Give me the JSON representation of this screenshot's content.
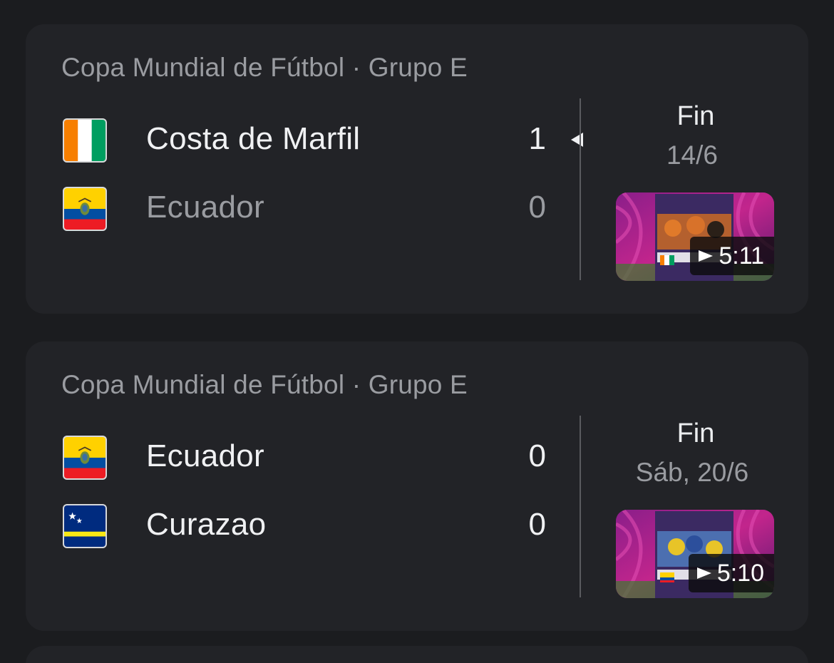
{
  "matches": [
    {
      "league": "Copa Mundial de Fútbol · Grupo E",
      "status": "Fin",
      "date": "14/6",
      "video_duration": "5:11",
      "teams": [
        {
          "name": "Costa de Marfil",
          "score": "1",
          "flag": "ivory-coast-flag-icon",
          "winner": true
        },
        {
          "name": "Ecuador",
          "score": "0",
          "flag": "ecuador-flag-icon",
          "winner": false
        }
      ]
    },
    {
      "league": "Copa Mundial de Fútbol · Grupo E",
      "status": "Fin",
      "date": "Sáb, 20/6",
      "video_duration": "5:10",
      "teams": [
        {
          "name": "Ecuador",
          "score": "0",
          "flag": "ecuador-flag-icon",
          "winner": false
        },
        {
          "name": "Curazao",
          "score": "0",
          "flag": "curacao-flag-icon",
          "winner": false
        }
      ]
    }
  ],
  "colors": {
    "background": "#1b1c1f",
    "card": "#222327",
    "text_primary": "#f0f1f3",
    "text_secondary": "#9a9ca1"
  }
}
